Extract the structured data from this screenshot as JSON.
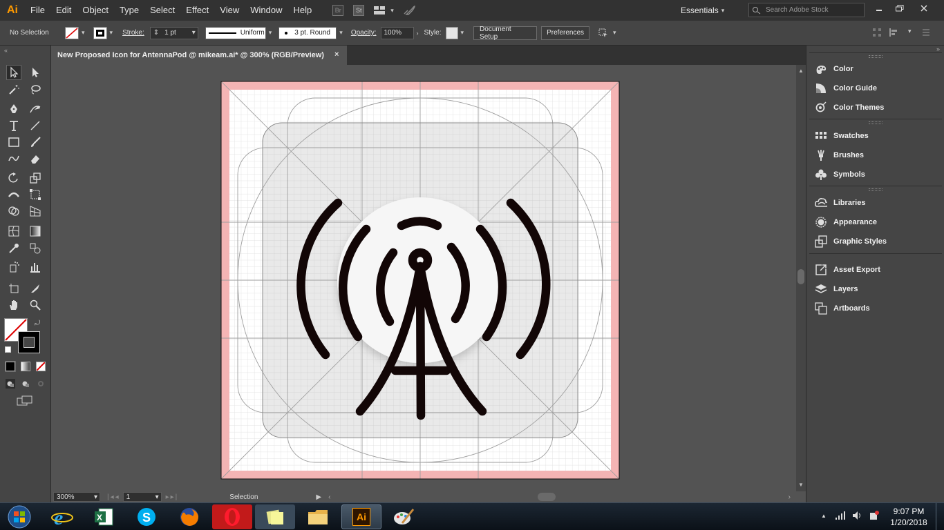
{
  "app": {
    "logo": "Ai"
  },
  "menus": [
    "File",
    "Edit",
    "Object",
    "Type",
    "Select",
    "Effect",
    "View",
    "Window",
    "Help"
  ],
  "menubar_icons": {
    "bridge": "Br",
    "stock": "St"
  },
  "workspace": "Essentials",
  "search_placeholder": "Search Adobe Stock",
  "control_bar": {
    "selection": "No Selection",
    "stroke_label": "Stroke:",
    "stroke_weight": "1 pt",
    "stroke_profile": "Uniform",
    "brush": "3 pt. Round",
    "opacity_label": "Opacity:",
    "opacity": "100%",
    "style_label": "Style:",
    "document_setup": "Document Setup",
    "preferences": "Preferences"
  },
  "document": {
    "tab_title": "New Proposed Icon for AntennaPod @ mikeam.ai* @ 300% (RGB/Preview)",
    "close": "×"
  },
  "status": {
    "zoom": "300%",
    "artboard": "1",
    "mode": "Selection"
  },
  "panels": [
    {
      "label": "Color",
      "icon": "color-icon"
    },
    {
      "label": "Color Guide",
      "icon": "color-guide-icon"
    },
    {
      "label": "Color Themes",
      "icon": "color-themes-icon"
    },
    {
      "label": "Swatches",
      "icon": "swatches-icon"
    },
    {
      "label": "Brushes",
      "icon": "brushes-icon"
    },
    {
      "label": "Symbols",
      "icon": "symbols-icon"
    },
    {
      "label": "Libraries",
      "icon": "libraries-icon"
    },
    {
      "label": "Appearance",
      "icon": "appearance-icon"
    },
    {
      "label": "Graphic Styles",
      "icon": "graphic-styles-icon"
    },
    {
      "label": "Asset Export",
      "icon": "asset-export-icon"
    },
    {
      "label": "Layers",
      "icon": "layers-icon"
    },
    {
      "label": "Artboards",
      "icon": "artboards-icon"
    }
  ],
  "taskbar": {
    "time": "9:07 PM",
    "date": "1/20/2018",
    "illustrator_label": "Ai"
  },
  "colors": {
    "artboard_bleed": "#f4b4b4",
    "antenna": "#120606",
    "accent": "#ff9a00"
  }
}
